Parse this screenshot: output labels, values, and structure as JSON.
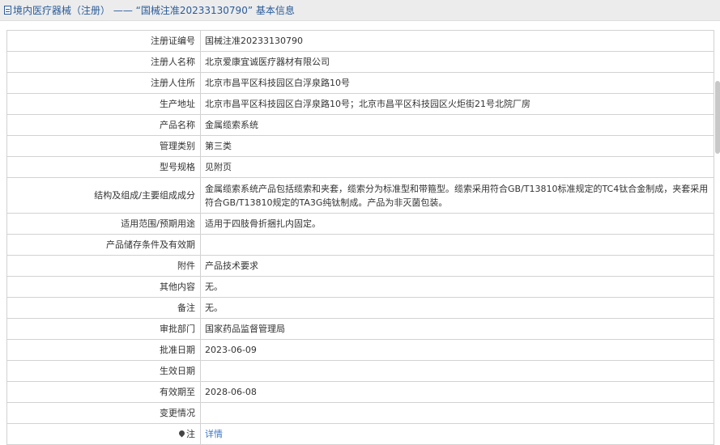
{
  "header": {
    "title": "境内医疗器械（注册） —— “国械注准20233130790” 基本信息"
  },
  "rows": [
    {
      "label": "注册证编号",
      "value": "国械注准20233130790"
    },
    {
      "label": "注册人名称",
      "value": "北京爱康宜诚医疗器材有限公司"
    },
    {
      "label": "注册人住所",
      "value": "北京市昌平区科技园区白浮泉路10号"
    },
    {
      "label": "生产地址",
      "value": "北京市昌平区科技园区白浮泉路10号；北京市昌平区科技园区火炬街21号北院厂房"
    },
    {
      "label": "产品名称",
      "value": "金属缆索系统"
    },
    {
      "label": "管理类别",
      "value": "第三类"
    },
    {
      "label": "型号规格",
      "value": "见附页"
    },
    {
      "label": "结构及组成/主要组成成分",
      "value": "金属缆索系统产品包括缆索和夹套，缆索分为标准型和带箍型。缆索采用符合GB/T13810标准规定的TC4钛合金制成，夹套采用符合GB/T13810规定的TA3G纯钛制成。产品为非灭菌包装。"
    },
    {
      "label": "适用范围/预期用途",
      "value": "适用于四肢骨折捆扎内固定。"
    },
    {
      "label": "产品储存条件及有效期",
      "value": ""
    },
    {
      "label": "附件",
      "value": "产品技术要求"
    },
    {
      "label": "其他内容",
      "value": "无。"
    },
    {
      "label": "备注",
      "value": "无。"
    },
    {
      "label": "审批部门",
      "value": "国家药品监督管理局"
    },
    {
      "label": "批准日期",
      "value": "2023-06-09"
    },
    {
      "label": "生效日期",
      "value": ""
    },
    {
      "label": "有效期至",
      "value": "2028-06-08"
    },
    {
      "label": "变更情况",
      "value": ""
    },
    {
      "label": "注",
      "value": "详情"
    }
  ],
  "icons": {
    "header": "document-icon",
    "note": "pin-icon"
  },
  "colors": {
    "header_bg": "#ececec",
    "header_text": "#2a5b9a",
    "link": "#3d76c4",
    "border": "#d2d2d2"
  }
}
